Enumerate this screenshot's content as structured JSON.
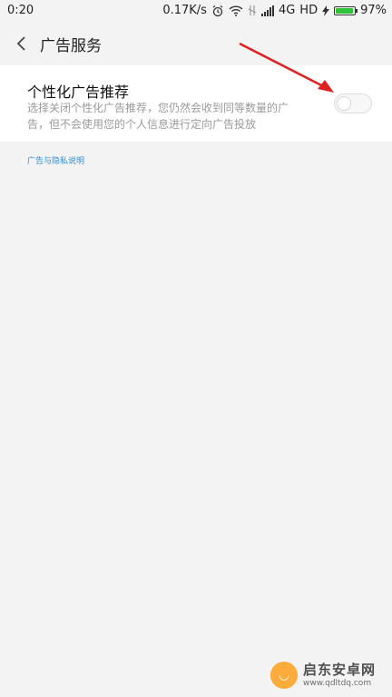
{
  "status_bar": {
    "time": "0:20",
    "network_speed": "0.17K/s",
    "network_type": "4G",
    "hd_label": "HD",
    "battery_percent": "97%",
    "battery_level": 0.97,
    "icons": [
      "alarm-icon",
      "wifi-icon",
      "no-sim-icon",
      "signal-icon",
      "charging-icon",
      "battery-icon"
    ]
  },
  "header": {
    "title": "广告服务",
    "back_icon": "chevron-left-icon"
  },
  "setting": {
    "title": "个性化广告推荐",
    "description": "选择关闭个性化广告推荐，您仍然会收到同等数量的广告，但不会使用您的个人信息进行定向广告投放",
    "toggle_on": false
  },
  "privacy_link": "广告与隐私说明",
  "watermark": {
    "name": "启东安卓网",
    "url": "www.qdltdq.com"
  },
  "colors": {
    "background": "#f3f3f3",
    "card": "#ffffff",
    "link": "#2a8fe0",
    "annotation_arrow": "#e02020"
  }
}
